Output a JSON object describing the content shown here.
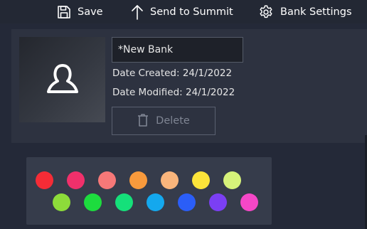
{
  "toolbar": {
    "save_label": "Save",
    "send_label": "Send to Summit",
    "settings_label": "Bank Settings"
  },
  "bank": {
    "name_value": "*New Bank",
    "date_created": "Date Created: 24/1/2022",
    "date_modified": "Date Modified: 24/1/2022",
    "delete_label": "Delete",
    "avatar_icon": "user-icon"
  },
  "palette": {
    "row1": [
      "#f52c36",
      "#f0306b",
      "#f67878",
      "#f89a3c",
      "#f9b57c",
      "#fce43a",
      "#d6f27a"
    ],
    "row2": [
      "#8ddc3a",
      "#1ddc3e",
      "#15e07a",
      "#14a8ee",
      "#2b5ef7",
      "#7b3ff3",
      "#f547c7"
    ]
  },
  "icons": {
    "save": "save-icon",
    "send": "arrow-up-icon",
    "settings": "gear-icon",
    "delete": "trash-icon"
  }
}
